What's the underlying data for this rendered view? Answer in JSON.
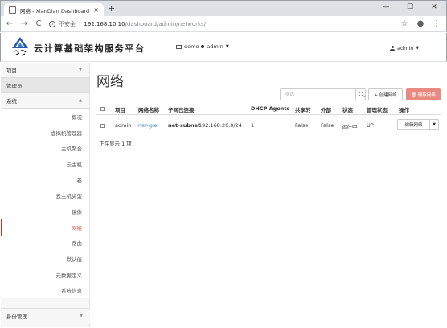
{
  "browser": {
    "tab_title": "网络 - XianDian Dashboard",
    "tab_close": "×",
    "new_tab": "+",
    "controls": [
      "—",
      "☐",
      "✕"
    ],
    "nav": {
      "back": "←",
      "forward": "→",
      "reload": "C"
    },
    "security_label": "不安全",
    "url_host": "192.168.10.10",
    "url_path": "/dashboard/admin/networks/",
    "star": "☆",
    "account": "●",
    "menu": "⋮"
  },
  "header": {
    "brand": "云计算基础架构服务平台",
    "project": "demo",
    "project_role": "admin",
    "user": "admin"
  },
  "sidebar": {
    "top_items": [
      {
        "label": "项目",
        "state": "collapsed"
      },
      {
        "label": "管理员",
        "state": "active"
      },
      {
        "label": "系统",
        "state": "expanded"
      }
    ],
    "system_items": [
      "概况",
      "虚拟机管理器",
      "主机聚合",
      "云主机",
      "卷",
      "云主机类型",
      "镜像",
      "网络",
      "路由",
      "默认值",
      "元数据定义",
      "系统信息"
    ],
    "selected_item": "网络",
    "bottom_item": "身份管理"
  },
  "main": {
    "title": "网络",
    "filter_placeholder": "筛选",
    "create_button": "+ 创建网络",
    "delete_button": "🗑 删除网络",
    "columns": [
      "项目",
      "网络名称",
      "子网已连接",
      "DHCP Agents",
      "共享的",
      "外部",
      "状态",
      "管理状态",
      "操作"
    ],
    "rows": [
      {
        "project": "admin",
        "name": "net-gre",
        "subnet_name": "net-subnet",
        "subnet_cidr": "192.168.20.0/24",
        "dhcp_agents": "1",
        "shared": "False",
        "external": "False",
        "status": "运行中",
        "admin_state": "UP",
        "action": "编辑网络"
      }
    ],
    "footer": "正在显示 1 项"
  }
}
